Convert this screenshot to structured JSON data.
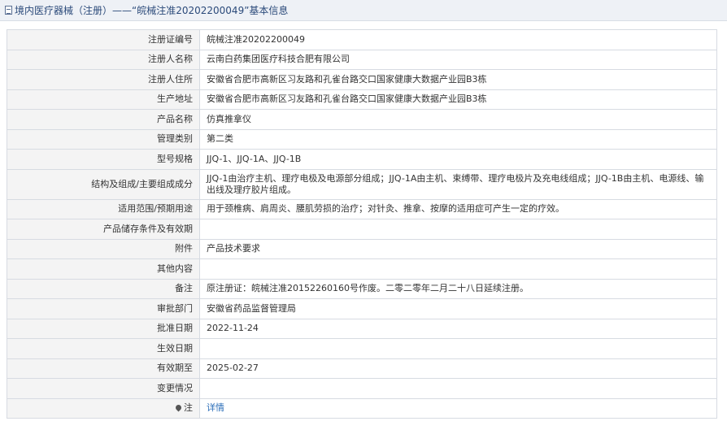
{
  "header": {
    "icon": "document-icon",
    "title": "境内医疗器械（注册）——“皖械注准20202200049”基本信息"
  },
  "rows": [
    {
      "label": "注册证编号",
      "value": "皖械注准20202200049"
    },
    {
      "label": "注册人名称",
      "value": "云南白药集团医疗科技合肥有限公司"
    },
    {
      "label": "注册人住所",
      "value": "安徽省合肥市高新区习友路和孔雀台路交口国家健康大数据产业园B3栋"
    },
    {
      "label": "生产地址",
      "value": "安徽省合肥市高新区习友路和孔雀台路交口国家健康大数据产业园B3栋"
    },
    {
      "label": "产品名称",
      "value": "仿真推拿仪"
    },
    {
      "label": "管理类别",
      "value": "第二类"
    },
    {
      "label": "型号规格",
      "value": "JJQ-1、JJQ-1A、JJQ-1B"
    },
    {
      "label": "结构及组成/主要组成成分",
      "value": "JJQ-1由治疗主机、理疗电极及电源部分组成；JJQ-1A由主机、束缚带、理疗电极片及充电线组成；JJQ-1B由主机、电源线、输出线及理疗胶片组成。"
    },
    {
      "label": "适用范围/预期用途",
      "value": "用于颈椎病、肩周炎、腰肌劳损的治疗；对针灸、推拿、按摩的适用症可产生一定的疗效。"
    },
    {
      "label": "产品储存条件及有效期",
      "value": ""
    },
    {
      "label": "附件",
      "value": "产品技术要求"
    },
    {
      "label": "其他内容",
      "value": ""
    },
    {
      "label": "备注",
      "value": "原注册证：皖械注准20152260160号作废。二零二零年二月二十八日延续注册。"
    },
    {
      "label": "审批部门",
      "value": "安徽省药品监督管理局"
    },
    {
      "label": "批准日期",
      "value": "2022-11-24"
    },
    {
      "label": "生效日期",
      "value": ""
    },
    {
      "label": "有效期至",
      "value": "2025-02-27"
    },
    {
      "label": "变更情况",
      "value": ""
    }
  ],
  "note": {
    "icon": "location-pin-icon",
    "label": "注",
    "link_text": "详情",
    "link_color": "#2a6db8"
  }
}
